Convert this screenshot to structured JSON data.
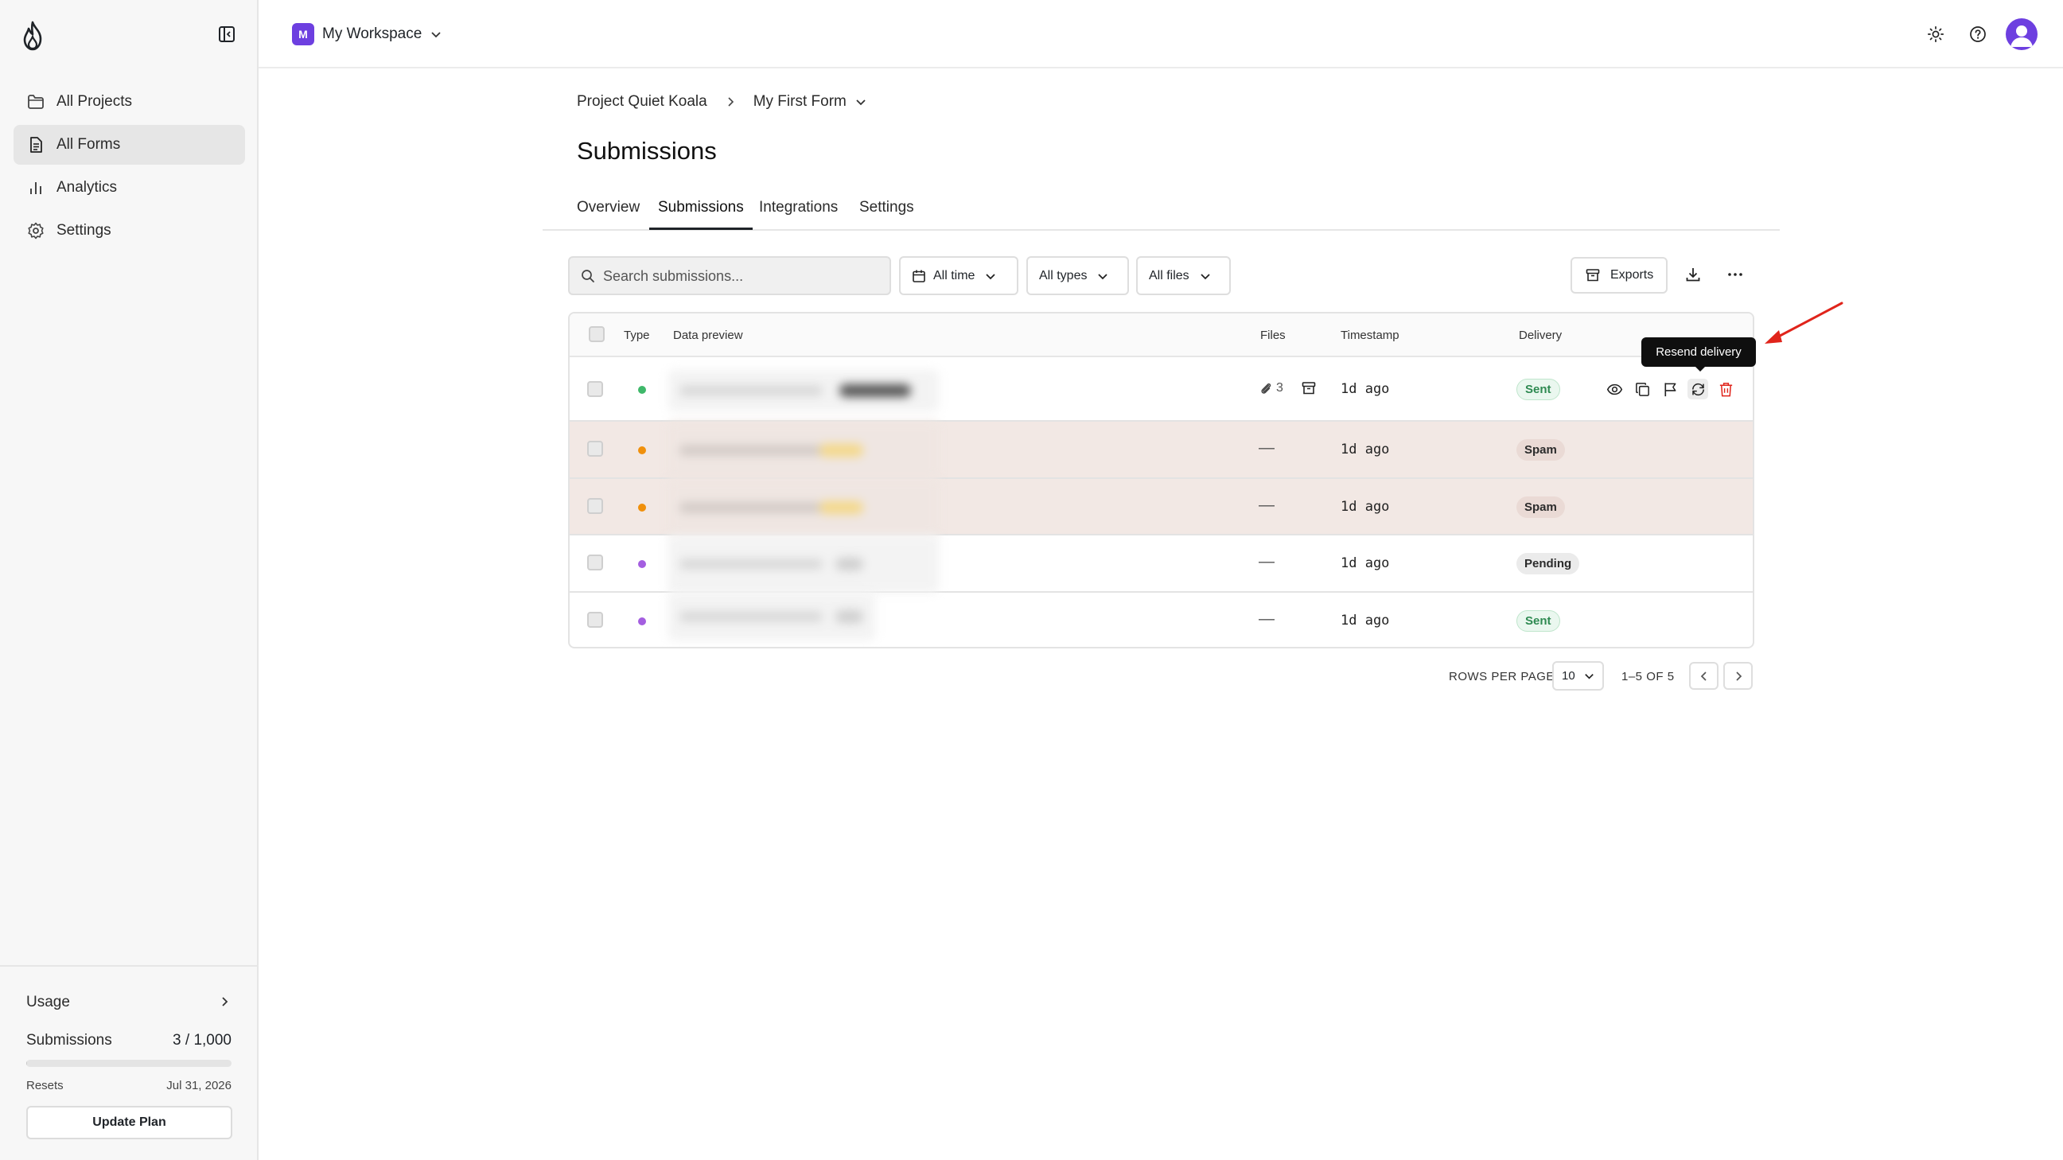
{
  "sidebar": {
    "items": [
      {
        "label": "All Projects",
        "icon": "folder-icon"
      },
      {
        "label": "All Forms",
        "icon": "document-icon",
        "active": true
      },
      {
        "label": "Analytics",
        "icon": "bar-chart-icon"
      },
      {
        "label": "Settings",
        "icon": "gear-icon"
      }
    ],
    "usage": {
      "title": "Usage",
      "submissions_label": "Submissions",
      "submissions_count": "3 / 1,000",
      "progress": 0.003,
      "resets_label": "Resets",
      "resets_date": "Jul 31, 2026",
      "update_plan_label": "Update Plan"
    }
  },
  "header": {
    "workspace_initial": "M",
    "workspace_name": "My Workspace",
    "accent_color": "#6d3fe0"
  },
  "breadcrumb": {
    "project": "Project Quiet Koala",
    "form": "My First Form"
  },
  "page": {
    "title": "Submissions",
    "tabs": [
      {
        "label": "Overview"
      },
      {
        "label": "Submissions",
        "active": true
      },
      {
        "label": "Integrations"
      },
      {
        "label": "Settings"
      }
    ]
  },
  "toolbar": {
    "search_placeholder": "Search submissions...",
    "filter_time": "All time",
    "filter_types": "All types",
    "filter_files": "All files",
    "exports_label": "Exports"
  },
  "table": {
    "columns": {
      "type": "Type",
      "preview": "Data preview",
      "files": "Files",
      "timestamp": "Timestamp",
      "delivery": "Delivery"
    },
    "rows": [
      {
        "type_color": "#3fb86a",
        "files": "3",
        "timestamp": "1d ago",
        "delivery": "Sent",
        "status": "sent"
      },
      {
        "type_color": "#f0900c",
        "files": "—",
        "timestamp": "1d ago",
        "delivery": "Spam",
        "status": "spam"
      },
      {
        "type_color": "#f0900c",
        "files": "—",
        "timestamp": "1d ago",
        "delivery": "Spam",
        "status": "spam"
      },
      {
        "type_color": "#a45ee0",
        "files": "—",
        "timestamp": "1d ago",
        "delivery": "Pending",
        "status": "pending"
      },
      {
        "type_color": "#a45ee0",
        "files": "—",
        "timestamp": "1d ago",
        "delivery": "Sent",
        "status": "sent"
      }
    ],
    "tooltip": "Resend delivery"
  },
  "pagination": {
    "rows_per_page_label": "ROWS PER PAGE",
    "rows_per_page_value": "10",
    "range": "1–5 OF 5"
  }
}
